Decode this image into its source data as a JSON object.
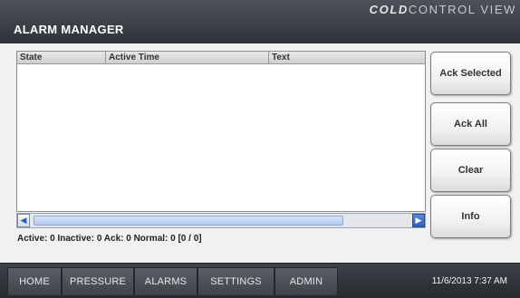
{
  "header": {
    "title": "ALARM MANAGER",
    "brand_part1": "COLD",
    "brand_part2": "CONTROL VIEW"
  },
  "table": {
    "columns": [
      "State",
      "Active Time",
      "Text"
    ],
    "rows": []
  },
  "status": {
    "text": "Active: 0  Inactive: 0  Ack: 0  Normal: 0   [0 / 0]"
  },
  "buttons": {
    "ack_selected": "Ack Selected",
    "ack_all": "Ack All",
    "clear": "Clear",
    "info": "Info"
  },
  "nav": {
    "tabs": [
      "HOME",
      "PRESSURE",
      "ALARMS",
      "SETTINGS",
      "ADMIN"
    ],
    "datetime": "11/6/2013 7:37 AM"
  }
}
